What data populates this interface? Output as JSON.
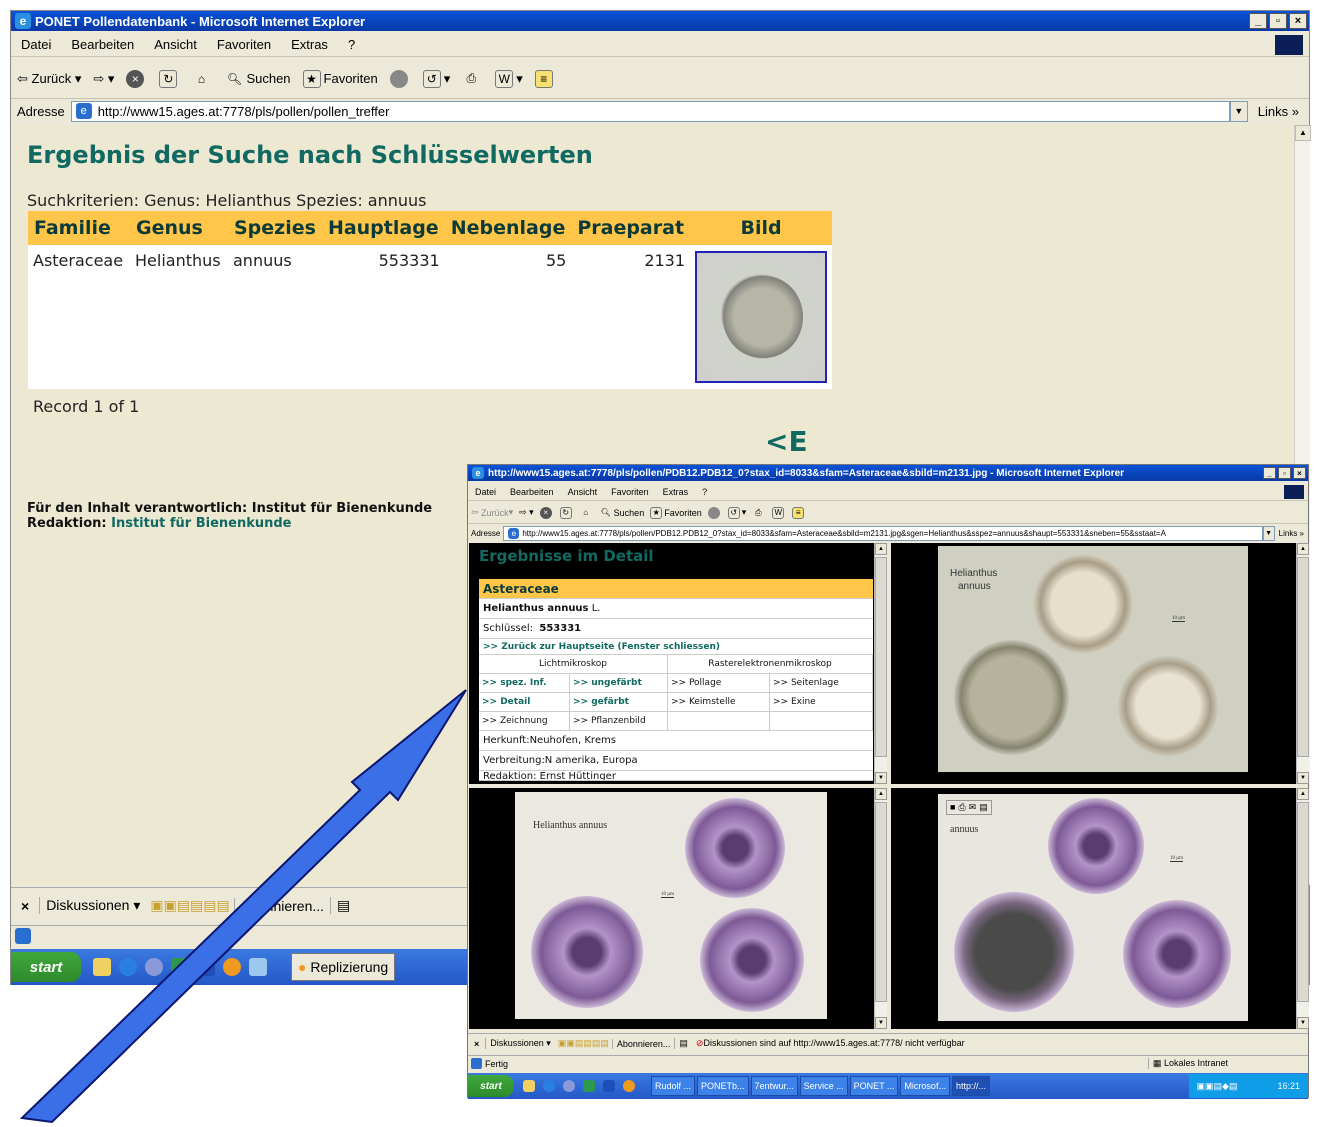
{
  "main": {
    "title": "PONET Pollendatenbank - Microsoft Internet Explorer",
    "menu": [
      "Datei",
      "Bearbeiten",
      "Ansicht",
      "Favoriten",
      "Extras",
      "?"
    ],
    "toolbar": {
      "back": "Zurück",
      "search": "Suchen",
      "favorites": "Favoriten"
    },
    "address_label": "Adresse",
    "url": "http://www15.ages.at:7778/pls/pollen/pollen_treffer",
    "links_label": "Links",
    "heading": "Ergebnis der Suche nach Schlüsselwerten",
    "criteria": "Suchkriterien: Genus: Helianthus Spezies: annuus",
    "table": {
      "headers": [
        "Familie",
        "Genus",
        "Spezies",
        "Hauptlage",
        "Nebenlage",
        "Praeparat",
        "Bild"
      ],
      "row": [
        "Asteraceae",
        "Helianthus",
        "annuus",
        "553331",
        "55",
        "2131"
      ]
    },
    "record": "Record 1 of 1",
    "back_arrow": "<E",
    "footer_line1": "Für den Inhalt verantwortlich: Institut für Bienenkunde",
    "footer_redaktion_label": "Redaktion:",
    "footer_redaktion_link": "Institut für Bienenkunde",
    "bottom_toolbar": {
      "discussions": "Diskussionen",
      "subscribe": "Abonnieren..."
    },
    "taskbar": {
      "start": "start",
      "task": "Replizierung"
    }
  },
  "popup": {
    "title": "http://www15.ages.at:7778/pls/pollen/PDB12.PDB12_0?stax_id=8033&sfam=Asteraceae&sbild=m2131.jpg - Microsoft Internet Explorer",
    "menu": [
      "Datei",
      "Bearbeiten",
      "Ansicht",
      "Favoriten",
      "Extras",
      "?"
    ],
    "toolbar": {
      "back": "Zurück",
      "search": "Suchen",
      "favorites": "Favoriten"
    },
    "address_label": "Adresse",
    "url": "http://www15.ages.at:7778/pls/pollen/PDB12.PDB12_0?stax_id=8033&sfam=Asteraceae&sbild=m2131.jpg&sgen=Helianthus&sspez=annuus&shaupt=553331&sneben=55&sstaat=A",
    "links_label": "Links",
    "detail": {
      "heading": "Ergebnisse im Detail",
      "family": "Asteraceae",
      "species_bold": "Helianthus annuus",
      "species_author": "L.",
      "key_label": "Schlüssel:",
      "key_value": "553331",
      "back_link": ">> Zurück zur Hauptseite (Fenster schliessen)",
      "col_light": "Lichtmikroskop",
      "col_sem": "Rasterelektronenmikroskop",
      "cells": [
        [
          ">> spez. Inf.",
          ">> ungefärbt",
          ">> Pollage",
          ">> Seitenlage"
        ],
        [
          ">> Detail",
          ">> gefärbt",
          ">> Keimstelle",
          ">> Exine"
        ],
        [
          ">> Zeichnung",
          ">> Pflanzenbild",
          "",
          ""
        ]
      ],
      "origin": "Herkunft:Neuhofen, Krems",
      "distribution": "Verbreitung:N amerika, Europa",
      "editor": "Redaktion: Ernst Hüttinger"
    },
    "photo_labels": {
      "tr_line1": "Helianthus",
      "tr_line2": "annuus",
      "tr_scale": "10 µm",
      "bl": "Helianthus annuus",
      "bl_scale": "10 µm",
      "br": "annuus",
      "br_scale": "10 µm"
    },
    "bottom_toolbar": {
      "discussions": "Diskussionen",
      "subscribe": "Abonnieren...",
      "message": "Diskussionen sind auf http://www15.ages.at:7778/ nicht verfügbar"
    },
    "status": {
      "left": "Fertig",
      "zone": "Lokales Intranet"
    },
    "taskbar": {
      "start": "start",
      "tasks": [
        "Rudolf ...",
        "PONETb...",
        "7entwur...",
        "Service ...",
        "PONET ...",
        "Microsof...",
        "http://..."
      ],
      "clock": "16:21"
    }
  },
  "colors": {
    "heading": "#106a62",
    "table_header": "#ffc649",
    "content_bg": "#ede8d2",
    "arrow": "#3a6fe8"
  }
}
